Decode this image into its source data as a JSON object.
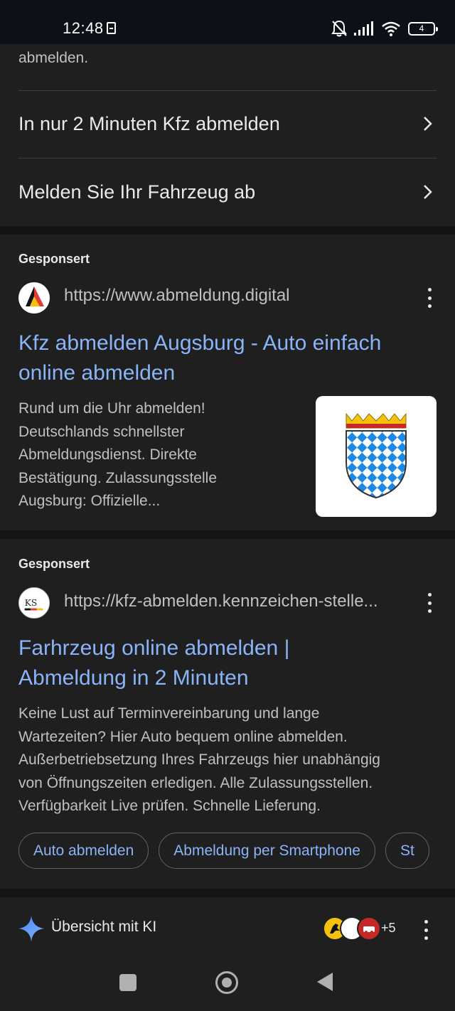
{
  "status_bar": {
    "time": "12:48",
    "battery_level": "4",
    "icons": [
      "battery-saver-icon",
      "bell-off-icon",
      "signal-icon",
      "wifi-icon",
      "battery-icon"
    ]
  },
  "top_card": {
    "faded_text": "abmelden.",
    "links": [
      {
        "label": "In nur 2 Minuten Kfz abmelden"
      },
      {
        "label": "Melden Sie Ihr Fahrzeug ab"
      }
    ]
  },
  "ads": [
    {
      "sponsored_label": "Gesponsert",
      "url": "https://www.abmeldung.digital",
      "title_line1": "Kfz abmelden Augsburg - Auto einfach",
      "title_line2": "online abmelden",
      "description": [
        "Rund um die Uhr abmelden!",
        "Deutschlands schnellster",
        "Abmeldungsdienst. Direkte",
        "Bestätigung. Zulassungsstelle",
        "Augsburg: Offizielle..."
      ]
    },
    {
      "sponsored_label": "Gesponsert",
      "url": "https://kfz-abmelden.kennzeichen-stelle...",
      "favicon_text": "KS",
      "title_line1": "Farhrzeug online abmelden |",
      "title_line2": "Abmeldung in 2 Minuten",
      "description": [
        "Keine Lust auf Terminvereinbarung und lange",
        "Wartezeiten? Hier Auto bequem online abmelden.",
        "Außerbetriebsetzung Ihres Fahrzeugs hier unabhängig",
        "von Öffnungszeiten erledigen. Alle Zulassungsstellen.",
        "Verfügbarkeit Live prüfen. Schnelle Lieferung."
      ],
      "chips": [
        "Auto abmelden",
        "Abmeldung per Smartphone",
        "St"
      ]
    }
  ],
  "ai_overview": {
    "label": "Übersicht mit KI",
    "more_count": "+5"
  },
  "colors": {
    "background": "#1f1f1f",
    "link": "#8ab4f8",
    "text": "#e8eaed",
    "muted": "#bdc1c6"
  }
}
